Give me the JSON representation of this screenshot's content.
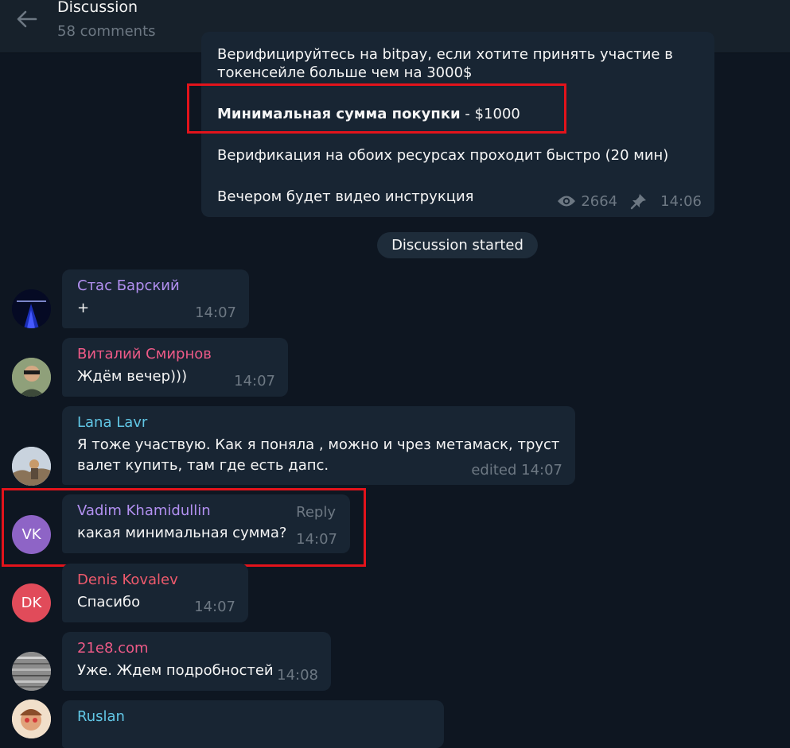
{
  "header": {
    "title": "Discussion",
    "subtitle": "58 comments",
    "back_icon": "arrow-left-icon"
  },
  "post": {
    "line1": "Верифицируйтесь на bitpay, если хотите принять участие в",
    "line2": "токенсейле больше чем на 3000$",
    "min_bold": "Минимальная сумма покупки",
    "min_rest": " - $1000",
    "verification": "Верификация на обоих ресурсах проходит быстро (20 мин)",
    "evening": "Вечером будет видео инструкция",
    "views": "2664",
    "time": "14:06",
    "views_icon": "eye-icon",
    "pinned_icon": "pin-icon"
  },
  "discussion_label": "Discussion started",
  "messages": [
    {
      "name": "Стас Барский",
      "text": "+",
      "time": "14:07",
      "name_color": "#b290f1"
    },
    {
      "name": "Виталий Смирнов",
      "text": "Ждём вечер)))",
      "time": "14:07",
      "name_color": "#ee5a87"
    },
    {
      "name": "Lana Lavr",
      "text_line1": "Я тоже участвую. Как я поняла , можно и чрез метамаск, труст",
      "text_line2": "валет купить, там где есть дапс.",
      "time": "edited 14:07",
      "name_color": "#61c6e5"
    },
    {
      "name": "Vadim Khamidullin",
      "text": "какая минимальная сумма?",
      "time": "14:07",
      "reply": "Reply",
      "initials": "VK",
      "name_color": "#b290f1",
      "avatar_color": "#8e64c6"
    },
    {
      "name": "Denis Kovalev",
      "text": "Спасибо",
      "time": "14:07",
      "initials": "DK",
      "name_color": "#ee5a6c",
      "avatar_color": "#e14b5a"
    },
    {
      "name": "21e8.com",
      "text": "Уже. Ждем подробностей",
      "time": "14:08",
      "name_color": "#ee5a87"
    },
    {
      "name": "Ruslan",
      "name_color": "#61c6e5"
    }
  ],
  "colors": {
    "background": "#0e1621",
    "bubble": "#182533",
    "header": "#17212b",
    "meta": "#6d7883",
    "highlight": "#e3131b"
  }
}
